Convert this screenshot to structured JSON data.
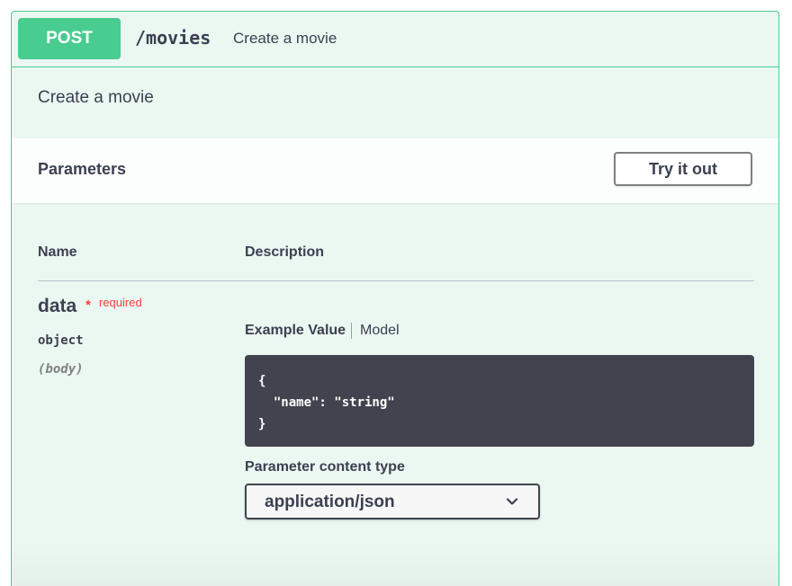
{
  "operation": {
    "method": "POST",
    "path": "/movies",
    "summary": "Create a movie",
    "description": "Create a movie"
  },
  "parameters_section": {
    "title": "Parameters",
    "try_button": "Try it out",
    "columns": {
      "name": "Name",
      "description": "Description"
    }
  },
  "parameter": {
    "name": "data",
    "required_star": "*",
    "required_label": "required",
    "type": "object",
    "in": "(body)",
    "tabs": {
      "example": "Example Value",
      "model": "Model"
    },
    "example_lines": [
      "{",
      "  \"name\": \"string\"",
      "}"
    ],
    "content_type_label": "Parameter content type",
    "content_type_value": "application/json"
  },
  "colors": {
    "post_accent": "#49cc90",
    "block_background": "#ebf7f1",
    "required": "#f93e3e",
    "code_background": "#41444e"
  }
}
